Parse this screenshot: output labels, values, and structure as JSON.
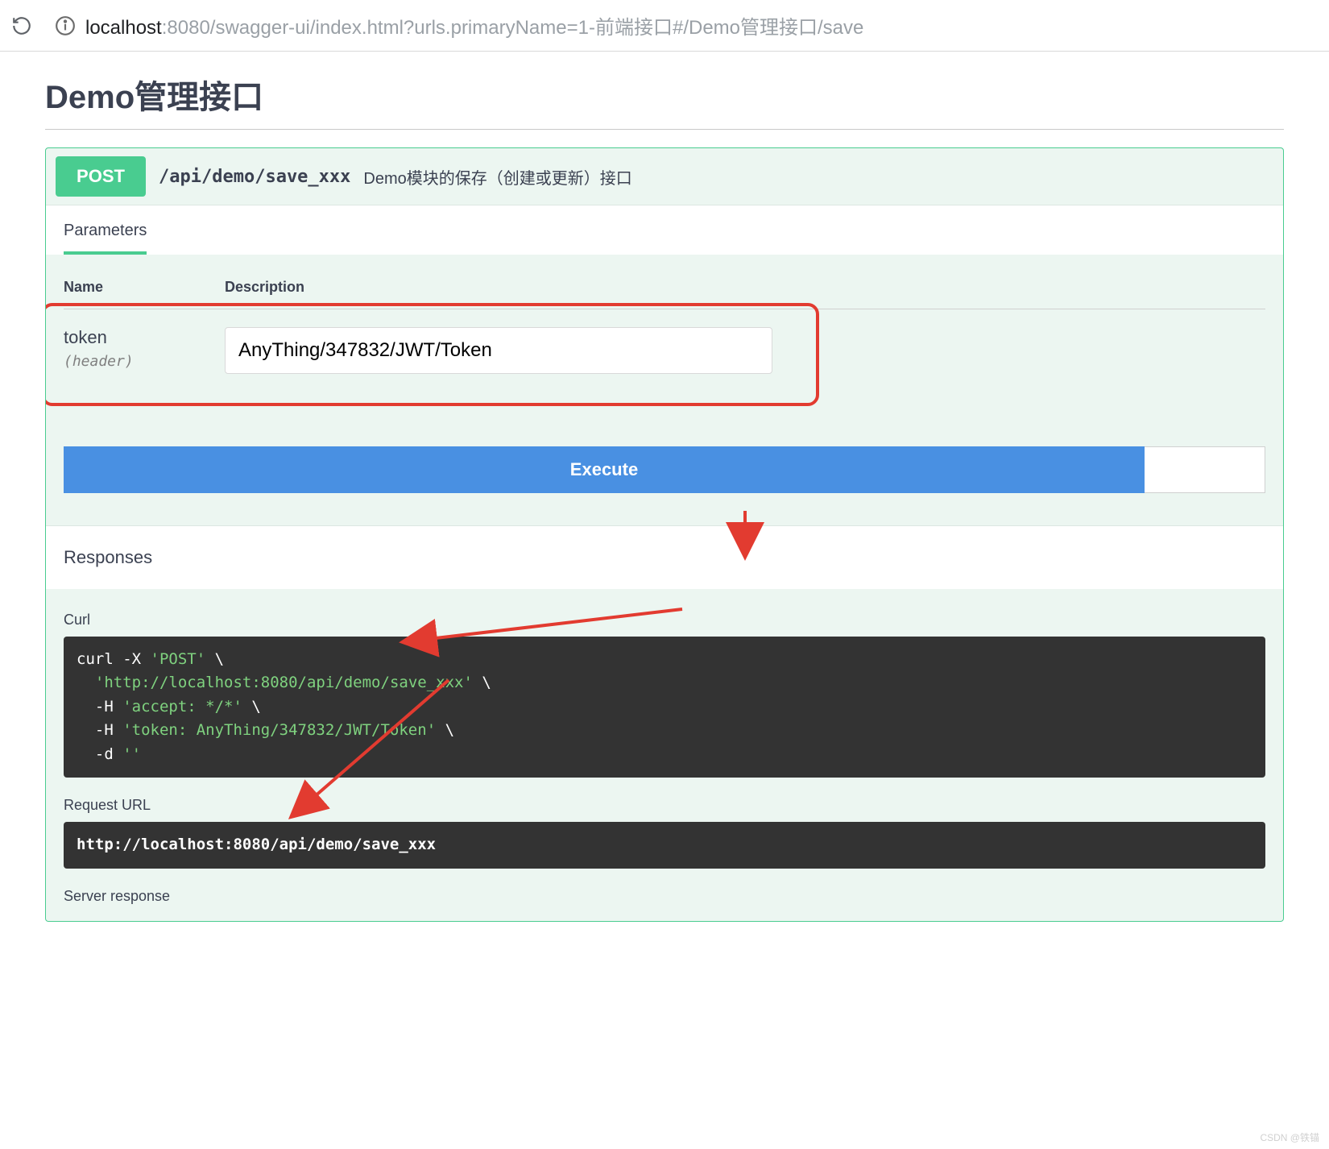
{
  "addr": {
    "url_host": "localhost",
    "url_port": ":8080",
    "url_path": "/swagger-ui/index.html?urls.primaryName=1-前端接口#/Demo管理接口/save"
  },
  "page": {
    "title": "Demo管理接口"
  },
  "op": {
    "method": "POST",
    "path": "/api/demo/save_xxx",
    "summary": "Demo模块的保存（创建或更新）接口"
  },
  "tabs": {
    "parameters": "Parameters",
    "responses": "Responses"
  },
  "param_table": {
    "col_name": "Name",
    "col_desc": "Description"
  },
  "param": {
    "name": "token",
    "in": "(header)",
    "value": "AnyThing/347832/JWT/Token"
  },
  "buttons": {
    "execute": "Execute"
  },
  "resp": {
    "curl_label": "Curl",
    "curl_code": "curl -X 'POST' \\\n  'http://localhost:8080/api/demo/save_xxx' \\\n  -H 'accept: */*' \\\n  -H 'token: AnyThing/347832/JWT/Token' \\\n  -d ''",
    "req_url_label": "Request URL",
    "req_url_value": "http://localhost:8080/api/demo/save_xxx",
    "server_resp_label": "Server response"
  },
  "watermark": "CSDN @铁锚"
}
